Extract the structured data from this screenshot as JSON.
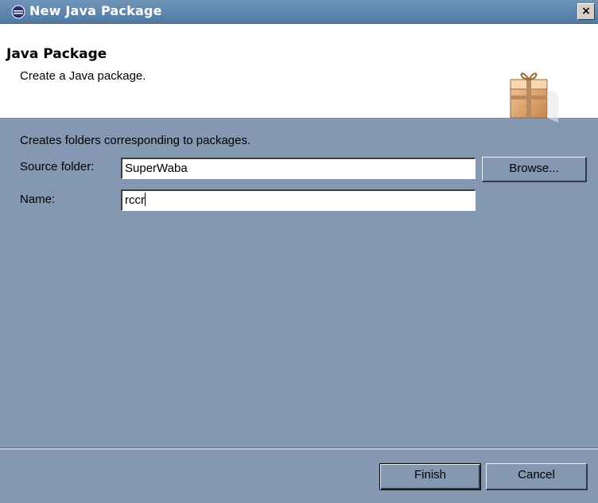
{
  "window": {
    "title": "New Java Package",
    "close_label": "×"
  },
  "header": {
    "title": "Java Package",
    "description": "Create a Java package."
  },
  "body": {
    "info": "Creates folders corresponding to packages.",
    "source_folder": {
      "label": "Source folder:",
      "value": "SuperWaba"
    },
    "name": {
      "label": "Name:",
      "value": "rccr"
    },
    "browse_label": "Browse..."
  },
  "footer": {
    "finish_label": "Finish",
    "cancel_label": "Cancel"
  },
  "icons": {
    "title_icon": "eclipse-icon",
    "header_icon": "package-icon"
  },
  "colors": {
    "dialog_bg": "#8498b2",
    "titlebar": "#4f7aa4",
    "header_bg": "#ffffff"
  }
}
